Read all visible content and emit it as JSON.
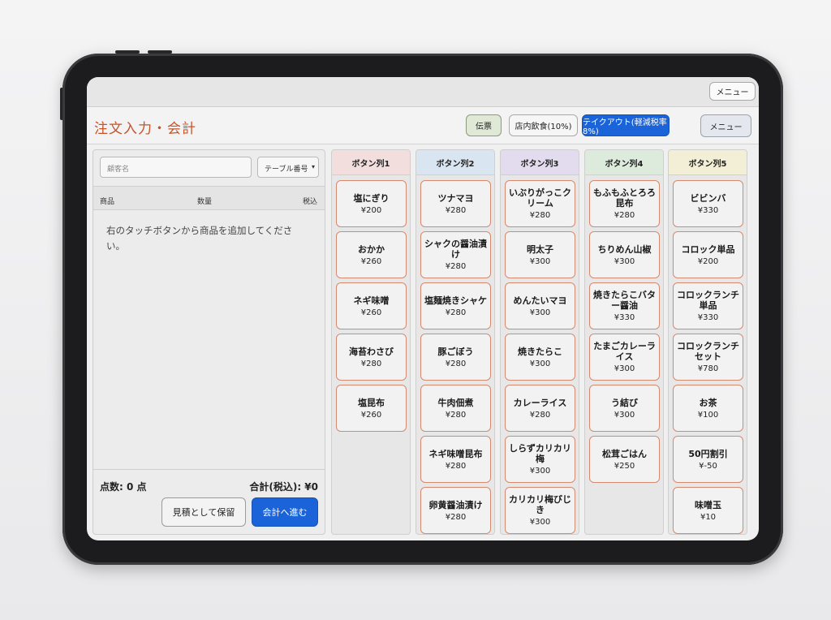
{
  "topbar": {
    "menu_label": "メニュー"
  },
  "header": {
    "title": "注文入力・会計",
    "slip_label": "伝票",
    "dine_in_label": "店内飲食(10%)",
    "takeout_label": "テイクアウト(軽減税率8%)",
    "menu_label": "メニュー"
  },
  "order": {
    "customer_placeholder": "顧客名",
    "table_select": "テーブル番号",
    "col_product": "商品",
    "col_qty": "数量",
    "col_tax": "税込",
    "empty_message": "右のタッチボタンから商品を追加してください。",
    "count_label": "点数: 0 点",
    "total_label": "合計(税込): ¥0",
    "hold_button": "見積として保留",
    "checkout_button": "会計へ進む"
  },
  "colors": {
    "accent_blue": "#1a63d8",
    "title_orange": "#c5532b",
    "col1_head": "#f3dede",
    "col2_head": "#d9e6f1",
    "col3_head": "#e3dcef",
    "col4_head": "#dcebdc",
    "col5_head": "#f2efd6"
  },
  "columns": [
    {
      "label": "ボタン列1",
      "items": [
        {
          "name": "塩にぎり",
          "price": "¥200"
        },
        {
          "name": "おかか",
          "price": "¥260"
        },
        {
          "name": "ネギ味噌",
          "price": "¥260"
        },
        {
          "name": "海苔わさび",
          "price": "¥280"
        },
        {
          "name": "塩昆布",
          "price": "¥260"
        }
      ]
    },
    {
      "label": "ボタン列2",
      "items": [
        {
          "name": "ツナマヨ",
          "price": "¥280"
        },
        {
          "name": "シャクの醤油漬け",
          "price": "¥280"
        },
        {
          "name": "塩麺焼きシャケ",
          "price": "¥280"
        },
        {
          "name": "豚ごぼう",
          "price": "¥280"
        },
        {
          "name": "牛肉佃煮",
          "price": "¥280"
        },
        {
          "name": "ネギ味噌昆布",
          "price": "¥280"
        },
        {
          "name": "卵黄醤油漬け",
          "price": "¥280"
        }
      ]
    },
    {
      "label": "ボタン列3",
      "items": [
        {
          "name": "いぶりがっこクリーム",
          "price": "¥280"
        },
        {
          "name": "明太子",
          "price": "¥300"
        },
        {
          "name": "めんたいマヨ",
          "price": "¥300"
        },
        {
          "name": "焼きたらこ",
          "price": "¥300"
        },
        {
          "name": "カレーライス",
          "price": "¥280"
        },
        {
          "name": "しらずカリカリ梅",
          "price": "¥300"
        },
        {
          "name": "カリカリ梅びじき",
          "price": "¥300"
        }
      ]
    },
    {
      "label": "ボタン列4",
      "items": [
        {
          "name": "もふもふとろろ昆布",
          "price": "¥280"
        },
        {
          "name": "ちりめん山椒",
          "price": "¥300"
        },
        {
          "name": "焼きたらこバター醤油",
          "price": "¥330"
        },
        {
          "name": "たまごカレーライス",
          "price": "¥300"
        },
        {
          "name": "う結び",
          "price": "¥300"
        },
        {
          "name": "松茸ごはん",
          "price": "¥250"
        }
      ]
    },
    {
      "label": "ボタン列5",
      "items": [
        {
          "name": "ビビンバ",
          "price": "¥330"
        },
        {
          "name": "コロック単品",
          "price": "¥200"
        },
        {
          "name": "コロックランチ単品",
          "price": "¥330"
        },
        {
          "name": "コロックランチセット",
          "price": "¥780"
        },
        {
          "name": "お茶",
          "price": "¥100"
        },
        {
          "name": "50円割引",
          "price": "¥-50"
        },
        {
          "name": "味噌玉",
          "price": "¥10"
        }
      ]
    }
  ]
}
